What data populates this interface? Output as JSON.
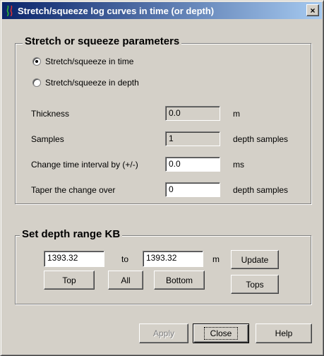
{
  "window": {
    "title": "Stretch/squeeze log curves in time (or depth)",
    "close_label": "×"
  },
  "params": {
    "group_title": "Stretch or squeeze parameters",
    "radio_time": {
      "label": "Stretch/squeeze in time",
      "checked": true
    },
    "radio_depth": {
      "label": "Stretch/squeeze in depth",
      "checked": false
    },
    "rows": {
      "thickness": {
        "label": "Thickness",
        "value": "0.0",
        "unit": "m"
      },
      "samples": {
        "label": "Samples",
        "value": "1",
        "unit": "depth samples"
      },
      "change": {
        "label": "Change time interval by (+/-)",
        "value": "0.0",
        "unit": "ms"
      },
      "taper": {
        "label": "Taper the change over",
        "value": "0",
        "unit": "depth samples"
      }
    }
  },
  "depth_range": {
    "group_title": "Set depth range KB",
    "top_value": "1393.32",
    "to_label": "to",
    "bottom_value": "1393.32",
    "unit": "m",
    "update_label": "Update",
    "top_label": "Top",
    "all_label": "All",
    "bottom_label": "Bottom",
    "tops_label": "Tops"
  },
  "footer": {
    "apply_label": "Apply",
    "close_label": "Close",
    "help_label": "Help"
  },
  "colors": {
    "face": "#d4d0c8",
    "title_start": "#0a246a",
    "title_end": "#a6caf0"
  }
}
